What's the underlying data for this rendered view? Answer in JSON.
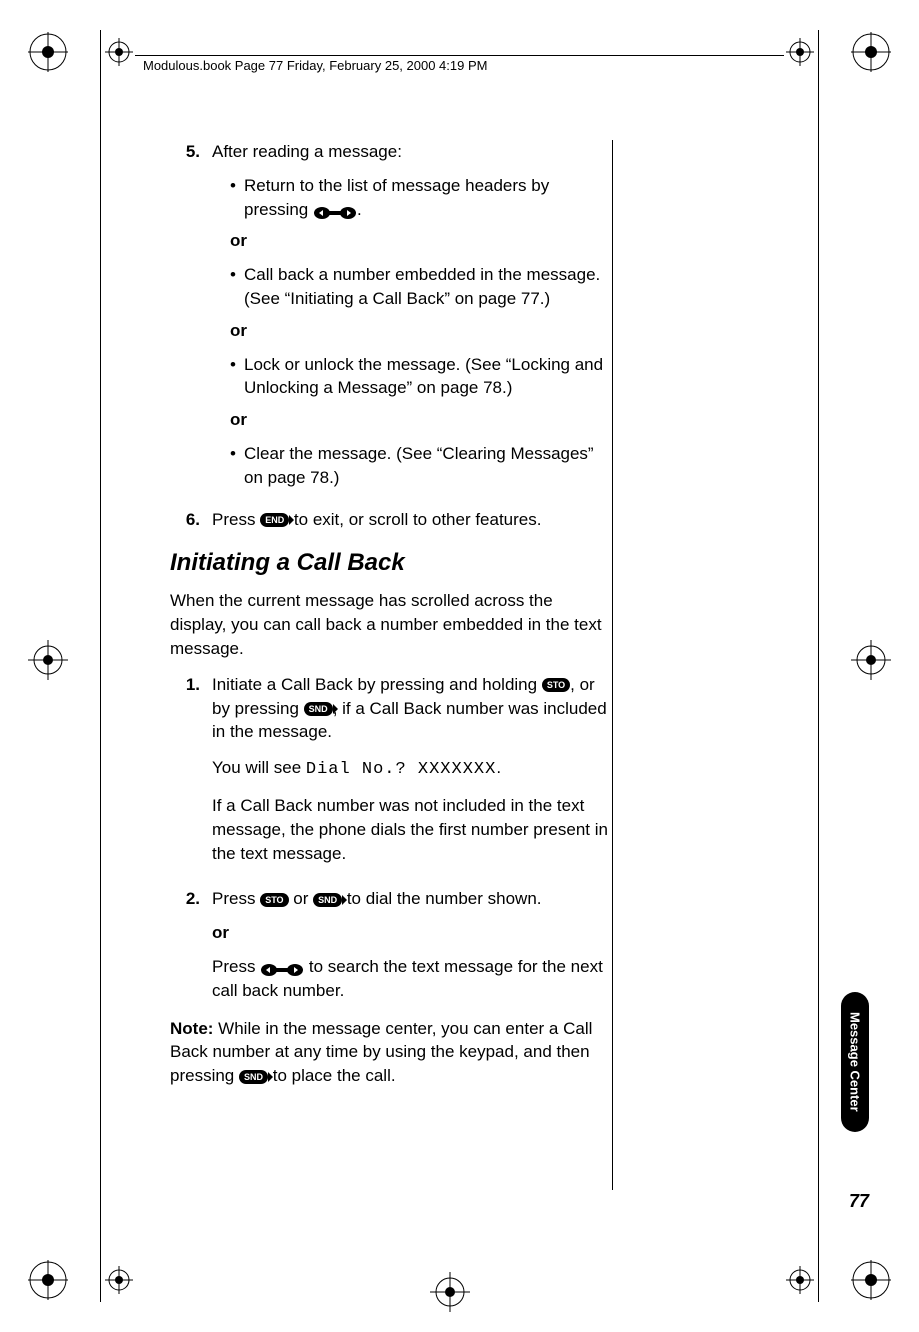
{
  "header": {
    "text": "Modulous.book  Page 77  Friday, February 25, 2000  4:19 PM"
  },
  "content": {
    "item5_num": "5.",
    "item5_lead": "After reading a message:",
    "bullet1a": "Return to the list of message headers by pressing ",
    "bullet1b": ".",
    "or": "or",
    "bullet2": "Call back a number embedded in the message. (See “Initiating a Call Back” on page 77.)",
    "bullet3": "Lock or unlock the message. (See “Locking and Unlocking a Message” on page 78.)",
    "bullet4": "Clear the message. (See “Clearing Messages” on page 78.)",
    "item6_num": "6.",
    "item6_a": "Press ",
    "item6_b": " to exit, or scroll to other features.",
    "heading": "Initiating a Call Back",
    "intro": "When the current message has scrolled across the display, you can call back a number embedded in the text message.",
    "s1_num": "1.",
    "s1_a": "Initiate a Call Back by pressing and holding ",
    "s1_b": ", or by pressing ",
    "s1_c": ", if a Call Back number was included in the message.",
    "s1_see_a": "You will see ",
    "s1_see_lcd": "Dial No.? XXXXXXX",
    "s1_see_b": ".",
    "s1_p2": "If a Call Back number was not included in the text message, the phone dials the first number present in the text message.",
    "s2_num": "2.",
    "s2_a": "Press ",
    "s2_b": " or ",
    "s2_c": " to dial the number shown.",
    "s2_or": "or",
    "s2_d": "Press ",
    "s2_e": " to search the text message for the next call back number.",
    "note_label": "Note: ",
    "note_a": "While in the message center, you can enter a Call Back number at any time by using the keypad, and then pressing ",
    "note_b": " to place the call."
  },
  "icons": {
    "end": "END",
    "sto": "STO",
    "snd": "SND"
  },
  "sideTab": "Message Center",
  "pageNumber": "77"
}
